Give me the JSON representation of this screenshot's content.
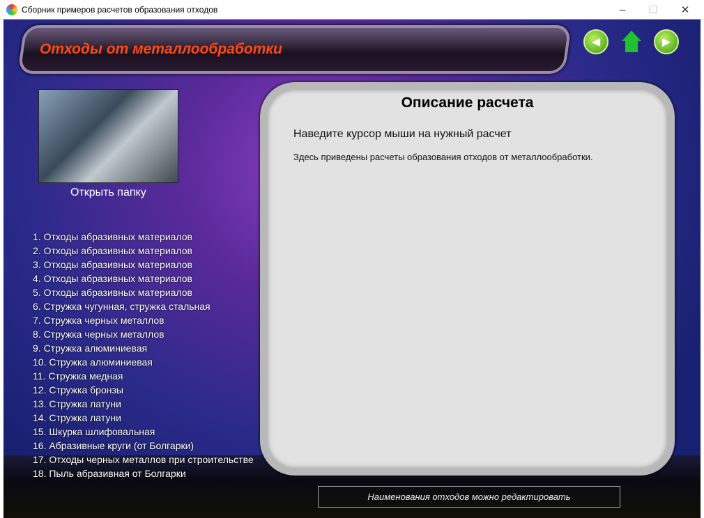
{
  "window": {
    "title": "Сборник примеров расчетов образования отходов",
    "minimize": "–",
    "maximize": "☐",
    "close": "✕"
  },
  "header": {
    "title": "Отходы от металлообработки",
    "back": "◀",
    "forward": "▶"
  },
  "sidebar": {
    "open_folder": "Открыть папку",
    "items": [
      "1. Отходы абразивных материалов",
      "2. Отходы абразивных материалов",
      "3. Отходы абразивных материалов",
      "4. Отходы абразивных материалов",
      "5. Отходы абразивных материалов",
      "6. Стружка чугунная, стружка стальная",
      "7. Стружка черных металлов",
      "8. Стружка черных металлов",
      "9. Стружка алюминиевая",
      "10. Стружка алюминиевая",
      "11. Стружка медная",
      "12. Стружка бронзы",
      "13. Стружка латуни",
      "14. Стружка латуни",
      "15. Шкурка шлифовальная",
      "16. Абразивные круги (от Болгарки)",
      "17. Отходы черных металлов при строительстве",
      "18. Пыль абразивная от Болгарки"
    ]
  },
  "panel": {
    "title": "Описание расчета",
    "hint": "Наведите курсор мыши на нужный расчет",
    "description": "Здесь приведены расчеты образования отходов от металлообработки."
  },
  "footer": {
    "note": "Наименования отходов можно редактировать"
  }
}
